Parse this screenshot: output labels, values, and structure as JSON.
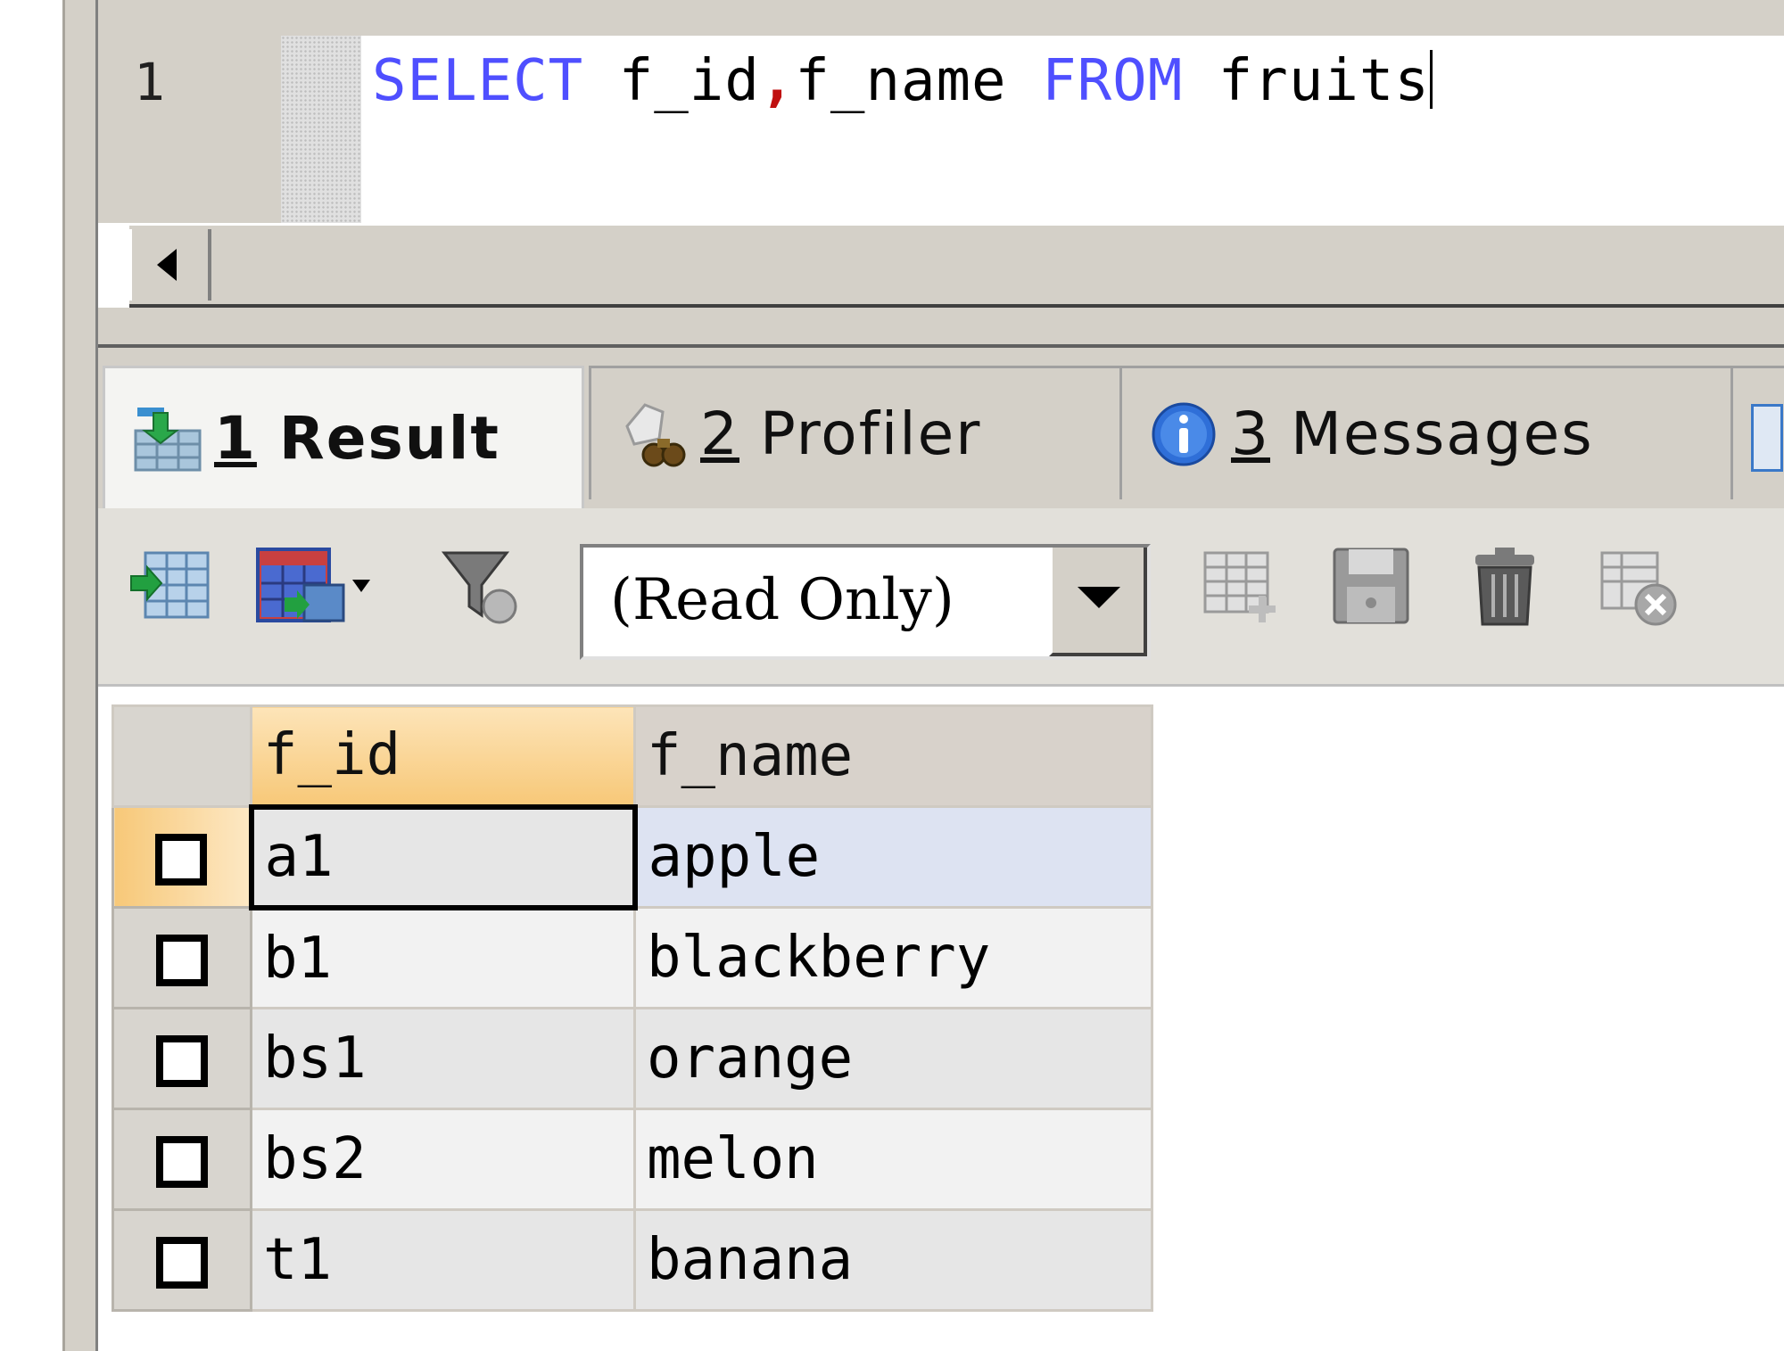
{
  "editor": {
    "line_number": "1",
    "sql": {
      "kw_select": "SELECT",
      "col1": "f_id",
      "comma": ",",
      "col2": "f_name",
      "kw_from": "FROM",
      "table": "fruits"
    }
  },
  "tabs": [
    {
      "number": "1",
      "label": "Result",
      "icon": "result-grid-icon"
    },
    {
      "number": "2",
      "label": "Profiler",
      "icon": "profiler-icon"
    },
    {
      "number": "3",
      "label": "Messages",
      "icon": "info-icon"
    }
  ],
  "toolbar": {
    "mode_select_value": "(Read Only)"
  },
  "grid": {
    "columns": [
      "f_id",
      "f_name"
    ],
    "rows": [
      {
        "f_id": "a1",
        "f_name": "apple"
      },
      {
        "f_id": "b1",
        "f_name": "blackberry"
      },
      {
        "f_id": "bs1",
        "f_name": "orange"
      },
      {
        "f_id": "bs2",
        "f_name": "melon"
      },
      {
        "f_id": "t1",
        "f_name": "banana"
      }
    ]
  },
  "colors": {
    "sql_keyword": "#4f4fff",
    "sql_punct": "#c01010",
    "sorted_header": "#f7c878",
    "active_row": "#dde3f2"
  }
}
